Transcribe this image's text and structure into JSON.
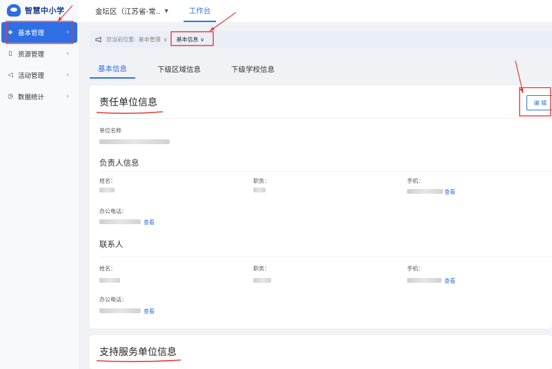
{
  "app": {
    "logo_text": "智慧中小学"
  },
  "sidebar": {
    "items": [
      {
        "label": "基本管理",
        "icon": "layers-icon",
        "glyph": "◈",
        "active": true
      },
      {
        "label": "资源管理",
        "icon": "file-icon",
        "glyph": "▯",
        "active": false
      },
      {
        "label": "活动管理",
        "icon": "megaphone-icon",
        "glyph": "◁",
        "active": false
      },
      {
        "label": "数据统计",
        "icon": "clock-icon",
        "glyph": "◷",
        "active": false
      }
    ],
    "chevron": "›"
  },
  "topbar": {
    "region": "金坛区（江苏省-常..",
    "region_caret": "▼",
    "workbench": "工作台"
  },
  "breadcrumb": {
    "prefix": "您当前位置:",
    "item1": "基本管理",
    "sep": "∨",
    "current": "基本信息 ∨"
  },
  "tabs": [
    {
      "label": "基本信息"
    },
    {
      "label": "下级区域信息"
    },
    {
      "label": "下级学校信息"
    }
  ],
  "card1": {
    "title": "责任单位信息",
    "edit": "编 辑",
    "unit_name_label": "单位名称",
    "leader_section": "负责人信息",
    "contact_section": "联系人",
    "name_label": "姓名：",
    "position_label": "职务：",
    "mobile_label": "手机：",
    "office_phone_label": "办公电话：",
    "view_link": "查看"
  },
  "card2": {
    "title": "支持服务单位信息"
  },
  "colors": {
    "accent": "#2f6fe6",
    "annotation": "#e53935"
  }
}
